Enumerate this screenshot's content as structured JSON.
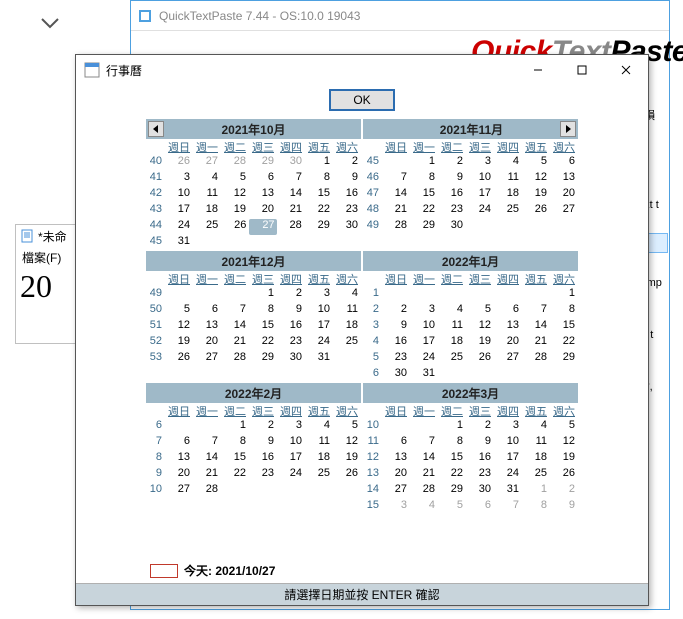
{
  "bg_chevron": "▾",
  "qtp": {
    "title": "QuickTextPaste 7.44 - OS:10.0 19043",
    "logo1": "Quick",
    "logo2": "Text",
    "logo3": "Paste",
    "side": [
      "# 損",
      "text t",
      "",
      "xamp",
      "nd t",
      ",*,*,",
      "",
      ""
    ]
  },
  "notepad": {
    "title": "*未命",
    "menu": "檔案(F)",
    "body": "20"
  },
  "dlg": {
    "title": "行事曆",
    "ok": "OK",
    "today_label": "今天: 2021/10/27",
    "footer": "請選擇日期並按 ENTER 確認"
  },
  "dow": [
    "週日",
    "週一",
    "週二",
    "週三",
    "週四",
    "週五",
    "週六"
  ],
  "months": [
    {
      "title": "2021年10月",
      "nav_prev": true,
      "weeks": [
        {
          "wk": 40,
          "days": [
            {
              "n": 26,
              "dim": true
            },
            {
              "n": 27,
              "dim": true
            },
            {
              "n": 28,
              "dim": true
            },
            {
              "n": 29,
              "dim": true
            },
            {
              "n": 30,
              "dim": true
            },
            {
              "n": 1
            },
            {
              "n": 2
            }
          ]
        },
        {
          "wk": 41,
          "days": [
            {
              "n": 3
            },
            {
              "n": 4
            },
            {
              "n": 5
            },
            {
              "n": 6
            },
            {
              "n": 7
            },
            {
              "n": 8
            },
            {
              "n": 9
            }
          ]
        },
        {
          "wk": 42,
          "days": [
            {
              "n": 10
            },
            {
              "n": 11
            },
            {
              "n": 12
            },
            {
              "n": 13
            },
            {
              "n": 14
            },
            {
              "n": 15
            },
            {
              "n": 16
            }
          ]
        },
        {
          "wk": 43,
          "days": [
            {
              "n": 17
            },
            {
              "n": 18
            },
            {
              "n": 19
            },
            {
              "n": 20
            },
            {
              "n": 21
            },
            {
              "n": 22
            },
            {
              "n": 23
            }
          ]
        },
        {
          "wk": 44,
          "days": [
            {
              "n": 24
            },
            {
              "n": 25
            },
            {
              "n": 26
            },
            {
              "n": 27,
              "sel": true
            },
            {
              "n": 28
            },
            {
              "n": 29
            },
            {
              "n": 30
            }
          ]
        },
        {
          "wk": 45,
          "days": [
            {
              "n": 31
            },
            {
              "n": ""
            },
            {
              "n": ""
            },
            {
              "n": ""
            },
            {
              "n": ""
            },
            {
              "n": ""
            },
            {
              "n": ""
            }
          ]
        }
      ]
    },
    {
      "title": "2021年11月",
      "nav_next": true,
      "weeks": [
        {
          "wk": 45,
          "days": [
            {
              "n": ""
            },
            {
              "n": 1
            },
            {
              "n": 2
            },
            {
              "n": 3
            },
            {
              "n": 4
            },
            {
              "n": 5
            },
            {
              "n": 6
            }
          ]
        },
        {
          "wk": 46,
          "days": [
            {
              "n": 7
            },
            {
              "n": 8
            },
            {
              "n": 9
            },
            {
              "n": 10
            },
            {
              "n": 11
            },
            {
              "n": 12
            },
            {
              "n": 13
            }
          ]
        },
        {
          "wk": 47,
          "days": [
            {
              "n": 14
            },
            {
              "n": 15
            },
            {
              "n": 16
            },
            {
              "n": 17
            },
            {
              "n": 18
            },
            {
              "n": 19
            },
            {
              "n": 20
            }
          ]
        },
        {
          "wk": 48,
          "days": [
            {
              "n": 21
            },
            {
              "n": 22
            },
            {
              "n": 23
            },
            {
              "n": 24
            },
            {
              "n": 25
            },
            {
              "n": 26
            },
            {
              "n": 27
            }
          ]
        },
        {
          "wk": 49,
          "days": [
            {
              "n": 28
            },
            {
              "n": 29
            },
            {
              "n": 30
            },
            {
              "n": ""
            },
            {
              "n": ""
            },
            {
              "n": ""
            },
            {
              "n": ""
            }
          ]
        },
        {
          "wk": "",
          "days": [
            {
              "n": ""
            },
            {
              "n": ""
            },
            {
              "n": ""
            },
            {
              "n": ""
            },
            {
              "n": ""
            },
            {
              "n": ""
            },
            {
              "n": ""
            }
          ]
        }
      ]
    },
    {
      "title": "2021年12月",
      "weeks": [
        {
          "wk": 49,
          "days": [
            {
              "n": ""
            },
            {
              "n": ""
            },
            {
              "n": ""
            },
            {
              "n": 1
            },
            {
              "n": 2
            },
            {
              "n": 3
            },
            {
              "n": 4
            }
          ]
        },
        {
          "wk": 50,
          "days": [
            {
              "n": 5
            },
            {
              "n": 6
            },
            {
              "n": 7
            },
            {
              "n": 8
            },
            {
              "n": 9
            },
            {
              "n": 10
            },
            {
              "n": 11
            }
          ]
        },
        {
          "wk": 51,
          "days": [
            {
              "n": 12
            },
            {
              "n": 13
            },
            {
              "n": 14
            },
            {
              "n": 15
            },
            {
              "n": 16
            },
            {
              "n": 17
            },
            {
              "n": 18
            }
          ]
        },
        {
          "wk": 52,
          "days": [
            {
              "n": 19
            },
            {
              "n": 20
            },
            {
              "n": 21
            },
            {
              "n": 22
            },
            {
              "n": 23
            },
            {
              "n": 24
            },
            {
              "n": 25
            }
          ]
        },
        {
          "wk": 53,
          "days": [
            {
              "n": 26
            },
            {
              "n": 27
            },
            {
              "n": 28
            },
            {
              "n": 29
            },
            {
              "n": 30
            },
            {
              "n": 31
            },
            {
              "n": ""
            }
          ]
        },
        {
          "wk": "",
          "days": [
            {
              "n": ""
            },
            {
              "n": ""
            },
            {
              "n": ""
            },
            {
              "n": ""
            },
            {
              "n": ""
            },
            {
              "n": ""
            },
            {
              "n": ""
            }
          ]
        }
      ]
    },
    {
      "title": "2022年1月",
      "weeks": [
        {
          "wk": 1,
          "days": [
            {
              "n": ""
            },
            {
              "n": ""
            },
            {
              "n": ""
            },
            {
              "n": ""
            },
            {
              "n": ""
            },
            {
              "n": ""
            },
            {
              "n": 1
            }
          ]
        },
        {
          "wk": 2,
          "days": [
            {
              "n": 2
            },
            {
              "n": 3
            },
            {
              "n": 4
            },
            {
              "n": 5
            },
            {
              "n": 6
            },
            {
              "n": 7
            },
            {
              "n": 8
            }
          ]
        },
        {
          "wk": 3,
          "days": [
            {
              "n": 9
            },
            {
              "n": 10
            },
            {
              "n": 11
            },
            {
              "n": 12
            },
            {
              "n": 13
            },
            {
              "n": 14
            },
            {
              "n": 15
            }
          ]
        },
        {
          "wk": 4,
          "days": [
            {
              "n": 16
            },
            {
              "n": 17
            },
            {
              "n": 18
            },
            {
              "n": 19
            },
            {
              "n": 20
            },
            {
              "n": 21
            },
            {
              "n": 22
            }
          ]
        },
        {
          "wk": 5,
          "days": [
            {
              "n": 23
            },
            {
              "n": 24
            },
            {
              "n": 25
            },
            {
              "n": 26
            },
            {
              "n": 27
            },
            {
              "n": 28
            },
            {
              "n": 29
            }
          ]
        },
        {
          "wk": 6,
          "days": [
            {
              "n": 30
            },
            {
              "n": 31
            },
            {
              "n": ""
            },
            {
              "n": ""
            },
            {
              "n": ""
            },
            {
              "n": ""
            },
            {
              "n": ""
            }
          ]
        }
      ]
    },
    {
      "title": "2022年2月",
      "weeks": [
        {
          "wk": 6,
          "days": [
            {
              "n": ""
            },
            {
              "n": ""
            },
            {
              "n": 1
            },
            {
              "n": 2
            },
            {
              "n": 3
            },
            {
              "n": 4
            },
            {
              "n": 5
            }
          ]
        },
        {
          "wk": 7,
          "days": [
            {
              "n": 6
            },
            {
              "n": 7
            },
            {
              "n": 8
            },
            {
              "n": 9
            },
            {
              "n": 10
            },
            {
              "n": 11
            },
            {
              "n": 12
            }
          ]
        },
        {
          "wk": 8,
          "days": [
            {
              "n": 13
            },
            {
              "n": 14
            },
            {
              "n": 15
            },
            {
              "n": 16
            },
            {
              "n": 17
            },
            {
              "n": 18
            },
            {
              "n": 19
            }
          ]
        },
        {
          "wk": 9,
          "days": [
            {
              "n": 20
            },
            {
              "n": 21
            },
            {
              "n": 22
            },
            {
              "n": 23
            },
            {
              "n": 24
            },
            {
              "n": 25
            },
            {
              "n": 26
            }
          ]
        },
        {
          "wk": 10,
          "days": [
            {
              "n": 27
            },
            {
              "n": 28
            },
            {
              "n": ""
            },
            {
              "n": ""
            },
            {
              "n": ""
            },
            {
              "n": ""
            },
            {
              "n": ""
            }
          ]
        },
        {
          "wk": "",
          "days": [
            {
              "n": ""
            },
            {
              "n": ""
            },
            {
              "n": ""
            },
            {
              "n": ""
            },
            {
              "n": ""
            },
            {
              "n": ""
            },
            {
              "n": ""
            }
          ]
        }
      ]
    },
    {
      "title": "2022年3月",
      "weeks": [
        {
          "wk": 10,
          "days": [
            {
              "n": ""
            },
            {
              "n": ""
            },
            {
              "n": 1
            },
            {
              "n": 2
            },
            {
              "n": 3
            },
            {
              "n": 4
            },
            {
              "n": 5
            }
          ]
        },
        {
          "wk": 11,
          "days": [
            {
              "n": 6
            },
            {
              "n": 7
            },
            {
              "n": 8
            },
            {
              "n": 9
            },
            {
              "n": 10
            },
            {
              "n": 11
            },
            {
              "n": 12
            }
          ]
        },
        {
          "wk": 12,
          "days": [
            {
              "n": 13
            },
            {
              "n": 14
            },
            {
              "n": 15
            },
            {
              "n": 16
            },
            {
              "n": 17
            },
            {
              "n": 18
            },
            {
              "n": 19
            }
          ]
        },
        {
          "wk": 13,
          "days": [
            {
              "n": 20
            },
            {
              "n": 21
            },
            {
              "n": 22
            },
            {
              "n": 23
            },
            {
              "n": 24
            },
            {
              "n": 25
            },
            {
              "n": 26
            }
          ]
        },
        {
          "wk": 14,
          "days": [
            {
              "n": 27
            },
            {
              "n": 28
            },
            {
              "n": 29
            },
            {
              "n": 30
            },
            {
              "n": 31
            },
            {
              "n": 1,
              "dim": true
            },
            {
              "n": 2,
              "dim": true
            }
          ]
        },
        {
          "wk": 15,
          "days": [
            {
              "n": 3,
              "dim": true
            },
            {
              "n": 4,
              "dim": true
            },
            {
              "n": 5,
              "dim": true
            },
            {
              "n": 6,
              "dim": true
            },
            {
              "n": 7,
              "dim": true
            },
            {
              "n": 8,
              "dim": true
            },
            {
              "n": 9,
              "dim": true
            }
          ]
        }
      ]
    }
  ]
}
